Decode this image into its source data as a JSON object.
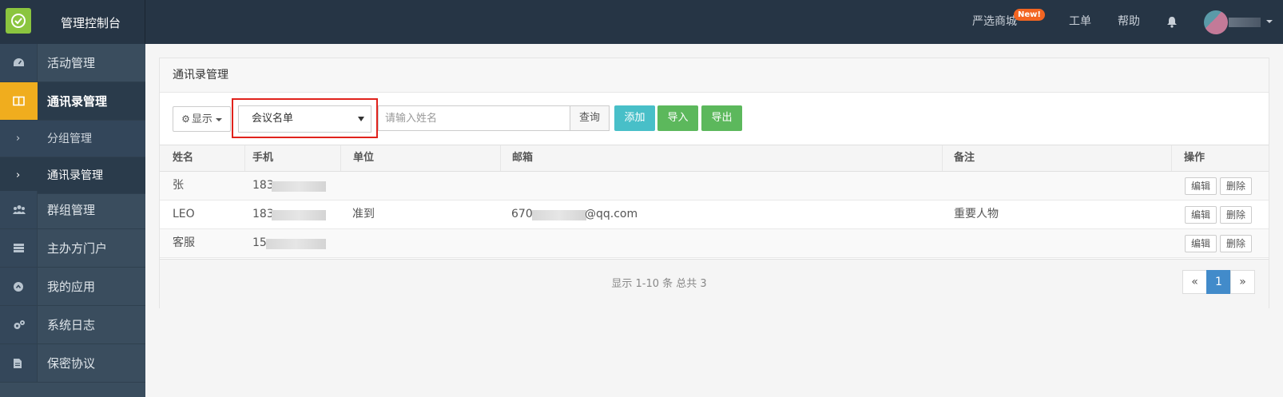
{
  "app": {
    "brand": "管理控制台"
  },
  "topnav": {
    "store_label": "严选商城",
    "new_badge": "New!",
    "ticket_label": "工单",
    "help_label": "帮助"
  },
  "sidebar": {
    "items": [
      {
        "label": "活动管理",
        "icon": "dashboard-icon"
      },
      {
        "label": "通讯录管理",
        "icon": "book-icon",
        "active": true
      },
      {
        "label": "群组管理",
        "icon": "users-icon"
      },
      {
        "label": "主办方门户",
        "icon": "server-icon"
      },
      {
        "label": "我的应用",
        "icon": "app-icon"
      },
      {
        "label": "系统日志",
        "icon": "gears-icon"
      },
      {
        "label": "保密协议",
        "icon": "file-icon"
      }
    ],
    "subitems": [
      {
        "label": "分组管理"
      },
      {
        "label": "通讯录管理",
        "active": true
      }
    ]
  },
  "panel": {
    "title": "通讯录管理",
    "display_label": "显示",
    "select_value": "会议名单",
    "search_placeholder": "请输入姓名",
    "query_label": "查询",
    "add_label": "添加",
    "import_label": "导入",
    "export_label": "导出"
  },
  "table": {
    "headers": {
      "name": "姓名",
      "phone": "手机",
      "company": "单位",
      "email": "邮箱",
      "note": "备注",
      "actions": "操作"
    },
    "rows": [
      {
        "name": "张",
        "phone": "183",
        "company": "",
        "email_prefix": "",
        "email_suffix": "",
        "note": "",
        "edit": "编辑",
        "delete": "删除"
      },
      {
        "name": "LEO",
        "phone": "183",
        "company": "准到",
        "email_prefix": "670",
        "email_suffix": "@qq.com",
        "note": "重要人物",
        "edit": "编辑",
        "delete": "删除"
      },
      {
        "name": "客服",
        "phone": "15",
        "company": "",
        "email_prefix": "",
        "email_suffix": "",
        "note": "",
        "edit": "编辑",
        "delete": "删除"
      }
    ]
  },
  "footer": {
    "page_info": "显示 1-10 条 总共 3",
    "prev": "«",
    "current_page": "1",
    "next": "»"
  },
  "colors": {
    "topbar": "#263545",
    "sidebar": "#3a4d5e",
    "active_accent": "#f0ad1e",
    "highlight_border": "#e0221c",
    "btn_add": "#48bfc8",
    "btn_green": "#5cb85c",
    "pager_active": "#428bca"
  }
}
